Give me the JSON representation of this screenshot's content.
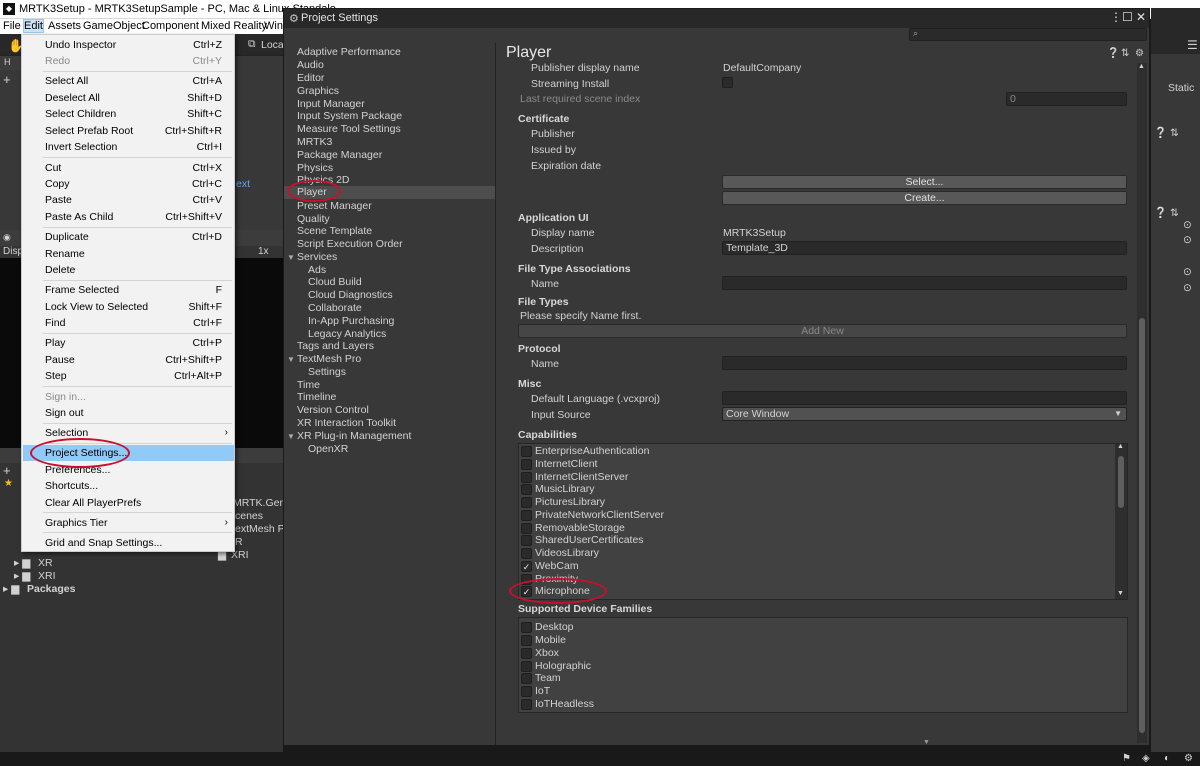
{
  "window": {
    "title_visible": "MRTK3Setup - MRTK3SetupSample - PC, Mac & Linux Standalo"
  },
  "menubar": [
    "File",
    "Edit",
    "Assets",
    "GameObject",
    "Component",
    "Mixed Reality",
    "Wind"
  ],
  "edit_menu": {
    "items": [
      {
        "label": "Undo Inspector",
        "shortcut": "Ctrl+Z"
      },
      {
        "label": "Redo",
        "shortcut": "Ctrl+Y",
        "disabled": true
      },
      {
        "label": "Select All",
        "shortcut": "Ctrl+A"
      },
      {
        "label": "Deselect All",
        "shortcut": "Shift+D"
      },
      {
        "label": "Select Children",
        "shortcut": "Shift+C"
      },
      {
        "label": "Select Prefab Root",
        "shortcut": "Ctrl+Shift+R"
      },
      {
        "label": "Invert Selection",
        "shortcut": "Ctrl+I"
      },
      {
        "label": "Cut",
        "shortcut": "Ctrl+X"
      },
      {
        "label": "Copy",
        "shortcut": "Ctrl+C"
      },
      {
        "label": "Paste",
        "shortcut": "Ctrl+V"
      },
      {
        "label": "Paste As Child",
        "shortcut": "Ctrl+Shift+V"
      },
      {
        "label": "Duplicate",
        "shortcut": "Ctrl+D"
      },
      {
        "label": "Rename",
        "shortcut": ""
      },
      {
        "label": "Delete",
        "shortcut": ""
      },
      {
        "label": "Frame Selected",
        "shortcut": "F"
      },
      {
        "label": "Lock View to Selected",
        "shortcut": "Shift+F"
      },
      {
        "label": "Find",
        "shortcut": "Ctrl+F"
      },
      {
        "label": "Play",
        "shortcut": "Ctrl+P"
      },
      {
        "label": "Pause",
        "shortcut": "Ctrl+Shift+P"
      },
      {
        "label": "Step",
        "shortcut": "Ctrl+Alt+P"
      },
      {
        "label": "Sign in...",
        "shortcut": "",
        "disabled": true
      },
      {
        "label": "Sign out",
        "shortcut": ""
      },
      {
        "label": "Selection",
        "shortcut": "",
        "submenu": true
      },
      {
        "label": "Project Settings...",
        "shortcut": "",
        "highlighted": true
      },
      {
        "label": "Preferences...",
        "shortcut": ""
      },
      {
        "label": "Shortcuts...",
        "shortcut": ""
      },
      {
        "label": "Clear All PlayerPrefs",
        "shortcut": ""
      },
      {
        "label": "Graphics Tier",
        "shortcut": "",
        "submenu": true
      },
      {
        "label": "Grid and Snap Settings...",
        "shortcut": ""
      }
    ]
  },
  "project_settings": {
    "title": "Project Settings",
    "nav": [
      "Adaptive Performance",
      "Audio",
      "Editor",
      "Graphics",
      "Input Manager",
      "Input System Package",
      "Measure Tool Settings",
      "MRTK3",
      "Package Manager",
      "Physics",
      "Physics 2D",
      "Player",
      "Preset Manager",
      "Quality",
      "Scene Template",
      "Script Execution Order",
      "Services",
      "Ads",
      "Cloud Build",
      "Cloud Diagnostics",
      "Collaborate",
      "In-App Purchasing",
      "Legacy Analytics",
      "Tags and Layers",
      "TextMesh Pro",
      "Settings",
      "Time",
      "Timeline",
      "Version Control",
      "XR Interaction Toolkit",
      "XR Plug-in Management",
      "OpenXR"
    ],
    "selected": "Player",
    "content": {
      "heading": "Player",
      "publisher_display_name_label": "Publisher display name",
      "publisher_display_name_value": "DefaultCompany",
      "streaming_install_label": "Streaming Install",
      "last_scene_index_label": "Last required scene index",
      "last_scene_index_value": "0",
      "certificate_header": "Certificate",
      "publisher_label": "Publisher",
      "issued_by_label": "Issued by",
      "expiration_label": "Expiration date",
      "select_button": "Select...",
      "create_button": "Create...",
      "app_ui_header": "Application UI",
      "display_name_label": "Display name",
      "display_name_value": "MRTK3Setup",
      "description_label": "Description",
      "description_value": "Template_3D",
      "fta_header": "File Type Associations",
      "name_label": "Name",
      "file_types_header": "File Types",
      "file_types_hint": "Please specify Name first.",
      "add_new_button": "Add New",
      "protocol_header": "Protocol",
      "protocol_name_label": "Name",
      "misc_header": "Misc",
      "default_language_label": "Default Language (.vcxproj)",
      "input_source_label": "Input Source",
      "input_source_value": "Core Window",
      "capabilities_header": "Capabilities",
      "capabilities": [
        {
          "name": "EnterpriseAuthentication",
          "checked": false
        },
        {
          "name": "InternetClient",
          "checked": false
        },
        {
          "name": "InternetClientServer",
          "checked": false
        },
        {
          "name": "MusicLibrary",
          "checked": false
        },
        {
          "name": "PicturesLibrary",
          "checked": false
        },
        {
          "name": "PrivateNetworkClientServer",
          "checked": false
        },
        {
          "name": "RemovableStorage",
          "checked": false
        },
        {
          "name": "SharedUserCertificates",
          "checked": false
        },
        {
          "name": "VideosLibrary",
          "checked": false
        },
        {
          "name": "WebCam",
          "checked": true
        },
        {
          "name": "Proximity",
          "checked": false
        },
        {
          "name": "Microphone",
          "checked": true
        }
      ],
      "device_families_header": "Supported Device Families",
      "device_families": [
        "Desktop",
        "Mobile",
        "Xbox",
        "Holographic",
        "Team",
        "IoT",
        "IoTHeadless"
      ]
    }
  },
  "background": {
    "toolbar_text": "Loca",
    "scene_link": "ext",
    "zoom": "1x",
    "static_label": "Static",
    "project_items": [
      "MRTK.Gene",
      "cenes",
      "extMesh P",
      "R",
      "XRI"
    ],
    "tree_items": [
      "XR",
      "XRI",
      "Packages"
    ]
  }
}
